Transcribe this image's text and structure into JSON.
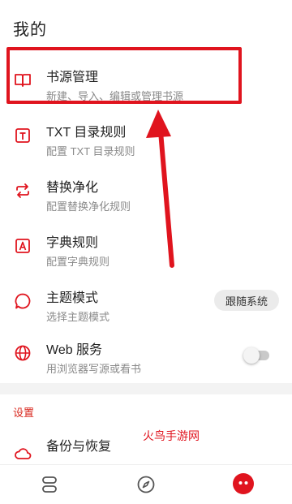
{
  "page": {
    "title": "我的"
  },
  "menu": {
    "items": [
      {
        "title": "书源管理",
        "subtitle": "新建、导入、编辑或管理书源",
        "icon": "book-open-icon"
      },
      {
        "title": "TXT 目录规则",
        "subtitle": "配置 TXT 目录规则",
        "icon": "txt-rule-icon"
      },
      {
        "title": "替换净化",
        "subtitle": "配置替换净化规则",
        "icon": "replace-arrows-icon"
      },
      {
        "title": "字典规则",
        "subtitle": "配置字典规则",
        "icon": "dictionary-icon"
      },
      {
        "title": "主题模式",
        "subtitle": "选择主题模式",
        "icon": "theme-bubble-icon",
        "value": "跟随系统"
      },
      {
        "title": "Web 服务",
        "subtitle": "用浏览器写源或看书",
        "icon": "globe-icon",
        "toggle_on": false
      }
    ]
  },
  "settings": {
    "section_label": "设置",
    "items": [
      {
        "title": "备份与恢复",
        "icon": "cloud-icon"
      }
    ]
  },
  "watermark": "火鸟手游网",
  "bottom_nav": {
    "items": [
      "bookshelf-icon",
      "explore-compass-icon",
      "mine-icon"
    ]
  },
  "colors": {
    "accent": "#e0141e",
    "highlight_box": "#e0141e",
    "arrow": "#e0141e"
  }
}
